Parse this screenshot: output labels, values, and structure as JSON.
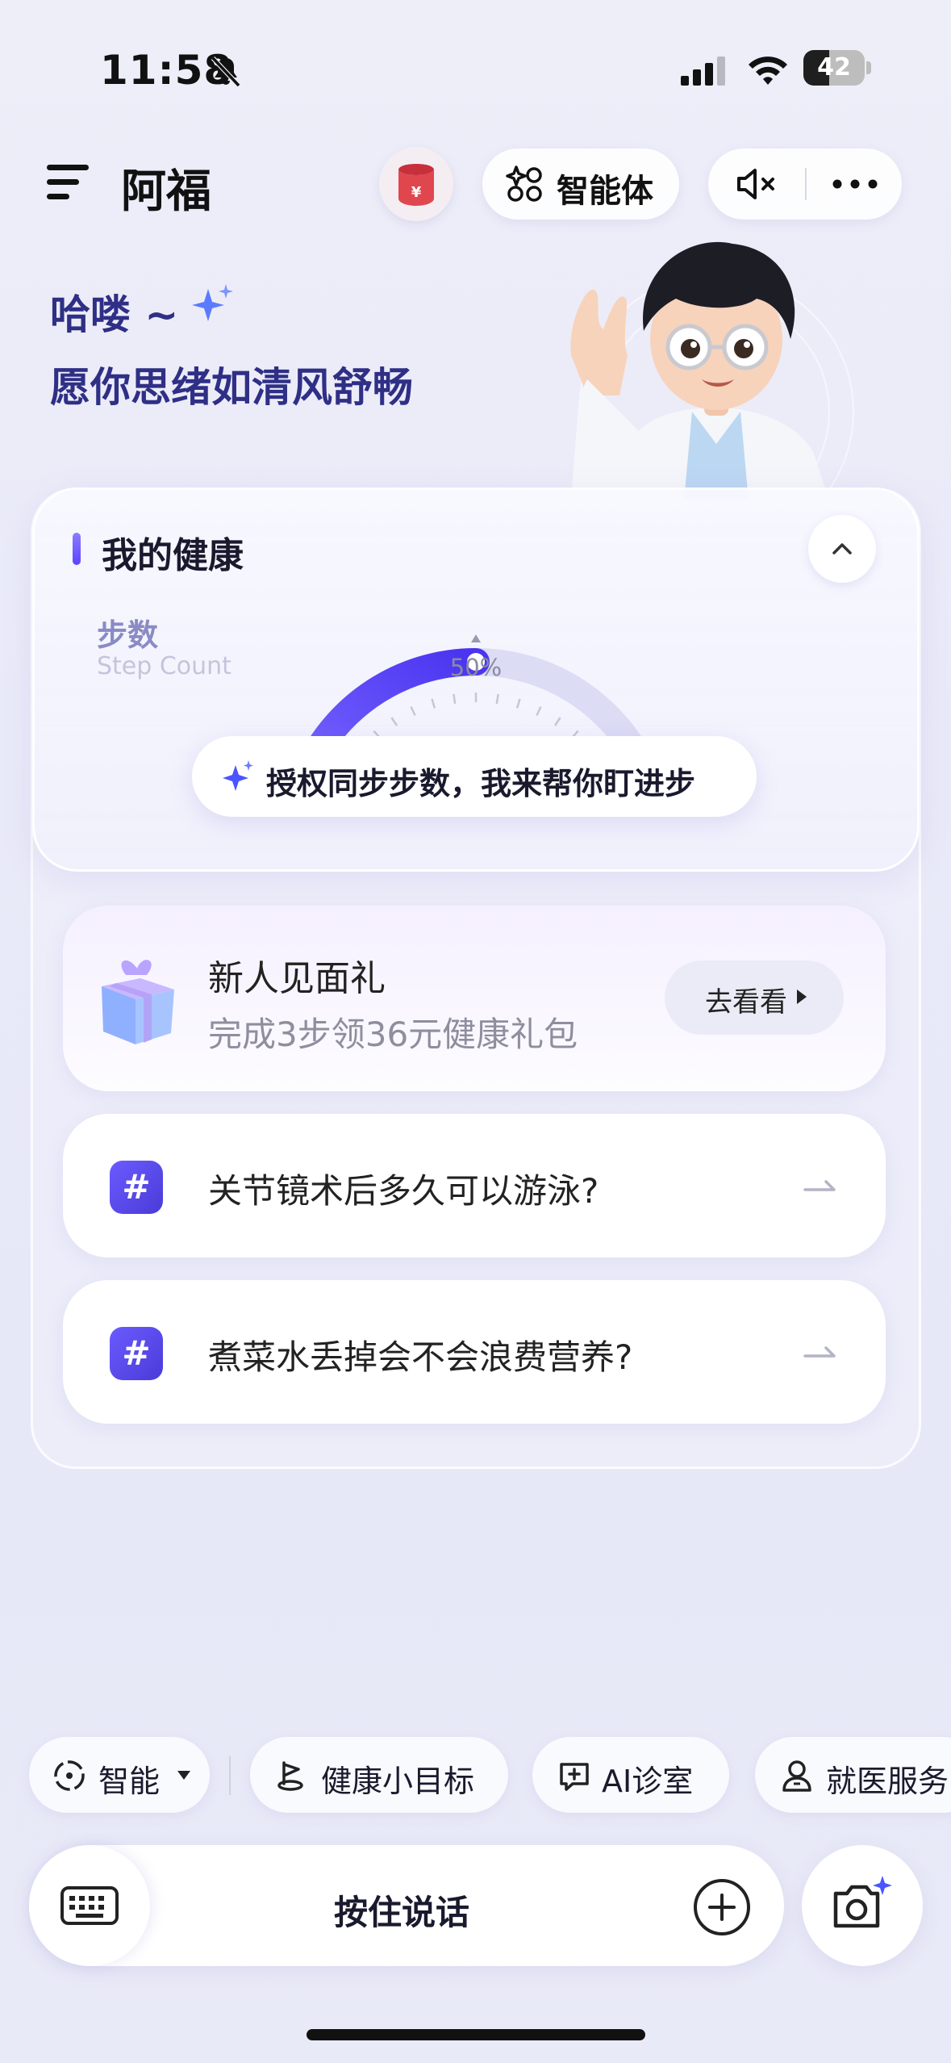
{
  "status_bar": {
    "time": "11:58",
    "battery": "42",
    "battery_level": 0.42
  },
  "header": {
    "title": "阿福",
    "agent_label": "智能体"
  },
  "greeting": {
    "line1": "哈喽 ~",
    "line2": "愿你思绪如清风舒畅"
  },
  "health": {
    "title": "我的健康",
    "step_label": "步数",
    "step_sublabel": "Step Count",
    "progress_text": "50%",
    "progress": 0.5,
    "sync_prompt": "授权同步步数，我来帮你盯进步"
  },
  "gift": {
    "title": "新人见面礼",
    "subtitle": "完成3步领36元健康礼包",
    "button": "去看看"
  },
  "questions": [
    {
      "hash": "#",
      "text": "关节镜术后多久可以游泳?"
    },
    {
      "hash": "#",
      "text": "煮菜水丢掉会不会浪费营养?"
    }
  ],
  "quick_actions": {
    "smart": "智能",
    "goal": "健康小目标",
    "ai_clinic": "AI诊室",
    "medical": "就医服务"
  },
  "input": {
    "hold_to_talk": "按住说话"
  },
  "colors": {
    "accent": "#5b45ff",
    "title_text": "#2f2f86"
  }
}
